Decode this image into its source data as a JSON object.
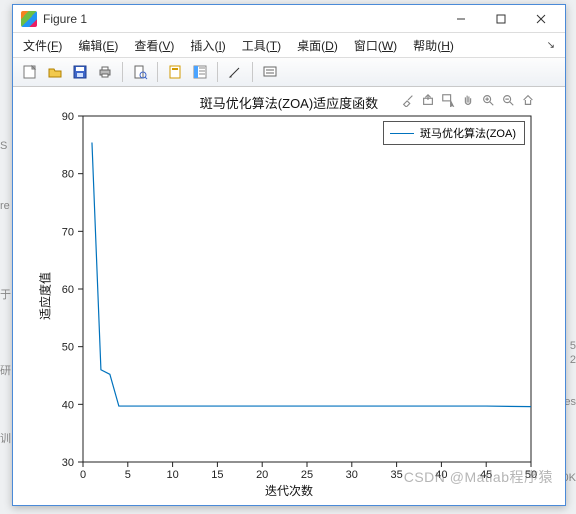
{
  "window": {
    "title": "Figure 1",
    "controls": {
      "minimize": "minimize",
      "maximize": "maximize",
      "close": "close"
    }
  },
  "menu": {
    "items": [
      {
        "label": "文件",
        "mnemonic": "F"
      },
      {
        "label": "编辑",
        "mnemonic": "E"
      },
      {
        "label": "查看",
        "mnemonic": "V"
      },
      {
        "label": "插入",
        "mnemonic": "I"
      },
      {
        "label": "工具",
        "mnemonic": "T"
      },
      {
        "label": "桌面",
        "mnemonic": "D"
      },
      {
        "label": "窗口",
        "mnemonic": "W"
      },
      {
        "label": "帮助",
        "mnemonic": "H"
      }
    ]
  },
  "toolbar": {
    "items": [
      "new",
      "open",
      "save",
      "print",
      "sep",
      "print-preview",
      "sep",
      "link",
      "sort",
      "sep",
      "cursor",
      "sep",
      "data-tip"
    ]
  },
  "axis_toolbar": {
    "items": [
      "brush",
      "export",
      "data-cursor",
      "pan",
      "zoom-in",
      "zoom-out",
      "home"
    ]
  },
  "chart_data": {
    "type": "line",
    "title": "斑马优化算法(ZOA)适应度函数",
    "xlabel": "迭代次数",
    "ylabel": "适应度值",
    "xlim": [
      0,
      50
    ],
    "ylim": [
      30,
      90
    ],
    "xticks": [
      0,
      5,
      10,
      15,
      20,
      25,
      30,
      35,
      40,
      45,
      50
    ],
    "yticks": [
      30,
      40,
      50,
      60,
      70,
      80,
      90
    ],
    "legend_position": "northeast",
    "series": [
      {
        "name": "斑马优化算法(ZOA)",
        "color": "#0072bd",
        "x": [
          1,
          2,
          3,
          4,
          5,
          10,
          15,
          20,
          25,
          30,
          35,
          40,
          45,
          50
        ],
        "values": [
          85.4,
          46.0,
          45.2,
          39.7,
          39.7,
          39.7,
          39.7,
          39.7,
          39.7,
          39.7,
          39.7,
          39.7,
          39.7,
          39.6
        ]
      }
    ]
  },
  "watermark": "CSDN @Matlab程序猿"
}
